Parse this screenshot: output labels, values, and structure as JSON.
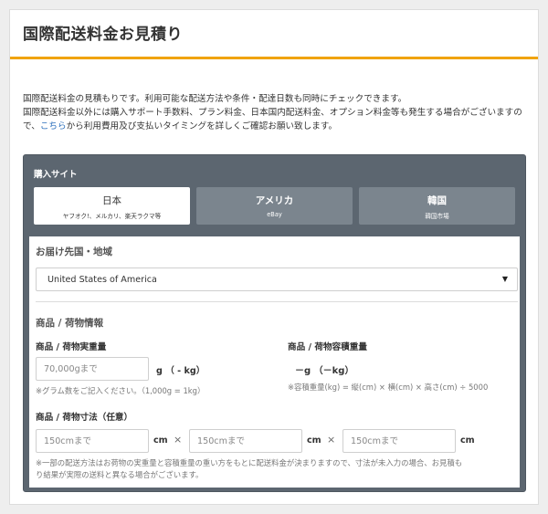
{
  "page": {
    "title": "国際配送料金お見積り",
    "intro_line1": "国際配送料金の見積もりです。利用可能な配送方法や条件・配達日数も同時にチェックできます。",
    "intro_line2": "国際配送料金以外には購入サポート手数料、プラン料金、日本国内配送料金、オプション料金等も発生する場合がございますので、",
    "intro_link": "こちら",
    "intro_line3": "から利用費用及び支払いタイミングを詳しくご確認お願い致します。"
  },
  "purchase_site": {
    "label": "購入サイト",
    "tabs": [
      {
        "name": "日本",
        "sub": "ヤフオク!、メルカリ、楽天ラクマ等",
        "active": true
      },
      {
        "name": "アメリカ",
        "sub": "eBay",
        "active": false
      },
      {
        "name": "韓国",
        "sub": "韓国市場",
        "active": false
      }
    ]
  },
  "destination": {
    "label": "お届け先国・地域",
    "selected": "United States of America"
  },
  "item": {
    "section_title": "商品 / 荷物情報",
    "weight_label": "商品 / 荷物実重量",
    "weight_placeholder": "70,000gまで",
    "weight_unit": "g （ - kg）",
    "weight_note": "※グラム数をご記入ください。（1,000g = 1kg）",
    "volumetric_label": "商品 / 荷物容積重量",
    "volumetric_value": "－g （－kg）",
    "volumetric_note": "※容積重量(kg) = 縦(cm) × 横(cm) × 高さ(cm) ÷ 5000",
    "size_label": "商品 / 荷物寸法（任意）",
    "dim_placeholder": "150cmまで",
    "dim_unit": "cm",
    "times": "×",
    "size_note_line1": "※一部の配送方法はお荷物の実重量と容積重量の重い方をもとに配送料金が決まりますので、寸法が未入力の場合、お見積も",
    "size_note_line2": "り結果が実際の送料と異なる場合がございます。"
  },
  "icons": {
    "select_arrow": "▼"
  }
}
